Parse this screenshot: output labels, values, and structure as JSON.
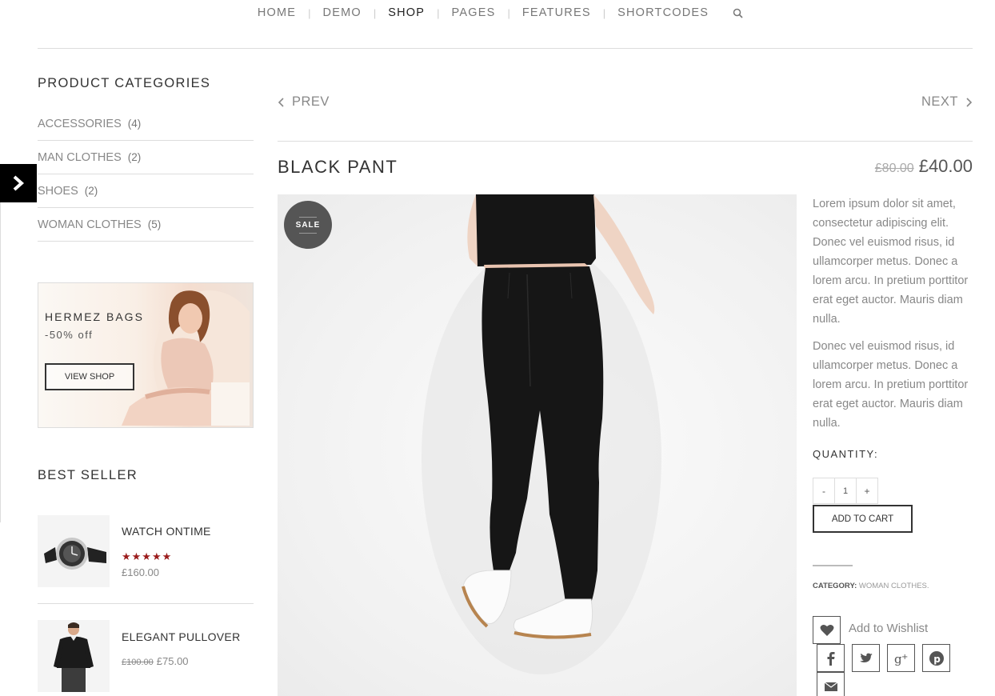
{
  "nav": {
    "items": [
      "HOME",
      "DEMO",
      "SHOP",
      "PAGES",
      "FEATURES",
      "SHORTCODES"
    ],
    "active": "SHOP",
    "search_icon": "search-icon"
  },
  "sidebar": {
    "categories_title": "PRODUCT CATEGORIES",
    "categories": [
      {
        "label": "ACCESSORIES",
        "count": "(4)"
      },
      {
        "label": "MAN CLOTHES",
        "count": "(2)"
      },
      {
        "label": "SHOES",
        "count": "(2)"
      },
      {
        "label": "WOMAN CLOTHES",
        "count": "(5)"
      }
    ],
    "banner": {
      "title": "HERMEZ BAGS",
      "subtitle": "-50% off",
      "button": "VIEW SHOP"
    },
    "best_seller_title": "BEST SELLER",
    "best_sellers": [
      {
        "name": "WATCH ONTIME",
        "rating": 5,
        "stars": "★★★★★",
        "price": "£160.00",
        "old_price": ""
      },
      {
        "name": "ELEGANT PULLOVER",
        "old_price": "£100.00",
        "price": "£75.00"
      }
    ]
  },
  "product_nav": {
    "prev": "PREV",
    "next": "NEXT"
  },
  "product": {
    "title": "BLACK PANT",
    "old_price": "£80.00",
    "price": "£40.00",
    "badge": "SALE",
    "description": [
      "Lorem ipsum dolor sit amet, consectetur adipiscing elit. Donec vel euismod risus, id ullamcorper metus. Donec a lorem arcu. In pretium porttitor erat eget auctor. Mauris diam nulla.",
      "Donec vel euismod risus, id ullamcorper metus. Donec a lorem arcu. In pretium porttitor erat eget auctor. Mauris diam nulla."
    ],
    "quantity_label": "QUANTITY:",
    "qty_minus": "-",
    "qty_value": "1",
    "qty_plus": "+",
    "add_to_cart": "ADD TO CART",
    "category_label": "CATEGORY:",
    "category_value": "WOMAN CLOTHES",
    "wishlist": "Add to Wishlist"
  },
  "colors": {
    "accent": "#9b1c1c",
    "dark": "#333333",
    "badge": "#555555"
  }
}
